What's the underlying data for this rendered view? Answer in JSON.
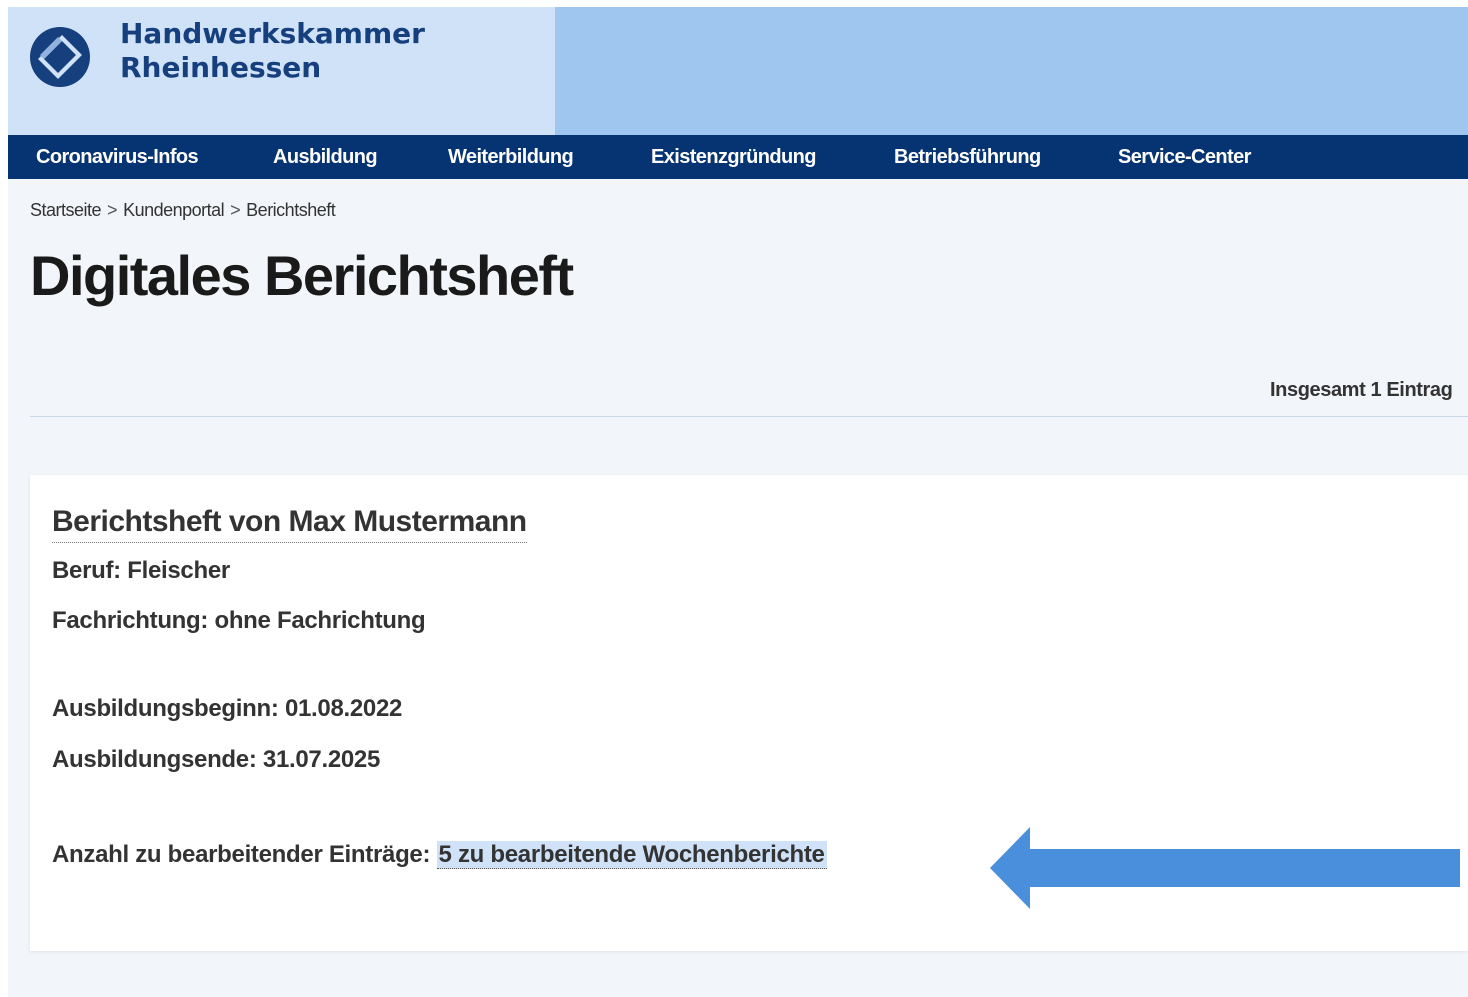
{
  "header": {
    "org_line1": "Handwerkskammer",
    "org_line2": "Rheinhessen",
    "logo_icon": "hwk-logo-icon",
    "colors": {
      "header_left": "#cfe2f8",
      "header_right": "#9fc6ef",
      "nav": "#063372"
    }
  },
  "nav": {
    "items": [
      {
        "label": "Coronavirus-Infos"
      },
      {
        "label": "Ausbildung"
      },
      {
        "label": "Weiterbildung"
      },
      {
        "label": "Existenzgründung"
      },
      {
        "label": "Betriebsführung"
      },
      {
        "label": "Service-Center"
      }
    ]
  },
  "breadcrumb": {
    "items": [
      {
        "label": "Startseite"
      },
      {
        "label": "Kundenportal"
      },
      {
        "label": "Berichtsheft"
      }
    ],
    "separator": ">"
  },
  "page": {
    "title": "Digitales Berichtsheft",
    "count": "Insgesamt 1 Eintrag"
  },
  "card": {
    "title": "Berichtsheft von Max Mustermann",
    "beruf": "Beruf: Fleischer",
    "fachrichtung": "Fachrichtung: ohne Fachrichtung",
    "beginn": "Ausbildungsbeginn: 01.08.2022",
    "ende": "Ausbildungsende: 31.07.2025",
    "entries_label": "Anzahl zu bearbeitender Einträge:",
    "entries_link": "5 zu bearbeitende Wochenberichte"
  },
  "annotation": {
    "arrow_color": "#4a8fdc",
    "arrow_icon": "left-arrow-icon"
  }
}
